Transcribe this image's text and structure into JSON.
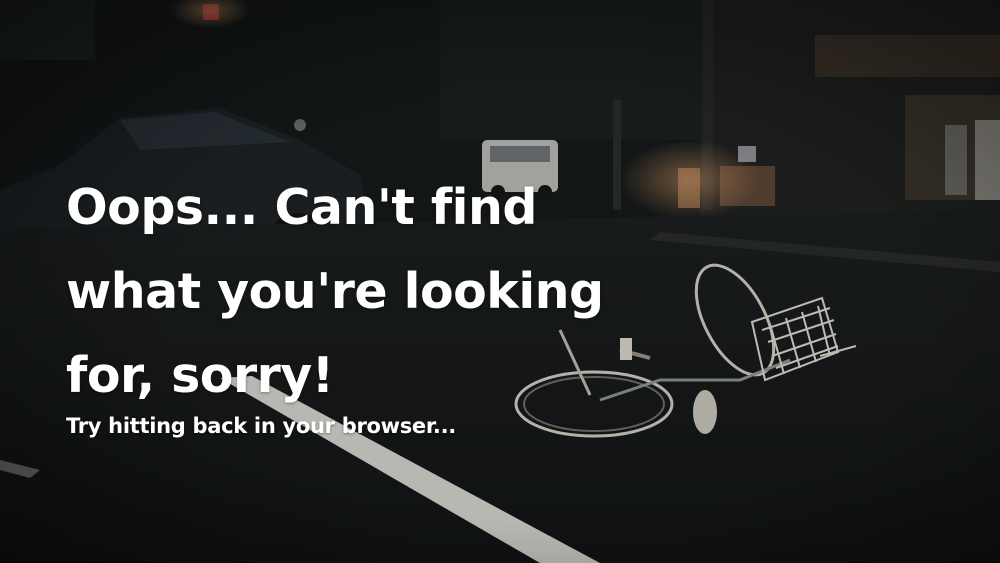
{
  "error_page": {
    "headline": "Oops... Can't find what you're looking for, sorry!",
    "subline": "Try hitting back in your browser..."
  },
  "background": {
    "description_icon": "night-street-fallen-bicycle-photo",
    "tones": {
      "sky": "#141818",
      "road": "#1a1d1e",
      "lane_marking": "#e8e6df",
      "warm_light": "#c98a5a"
    }
  }
}
